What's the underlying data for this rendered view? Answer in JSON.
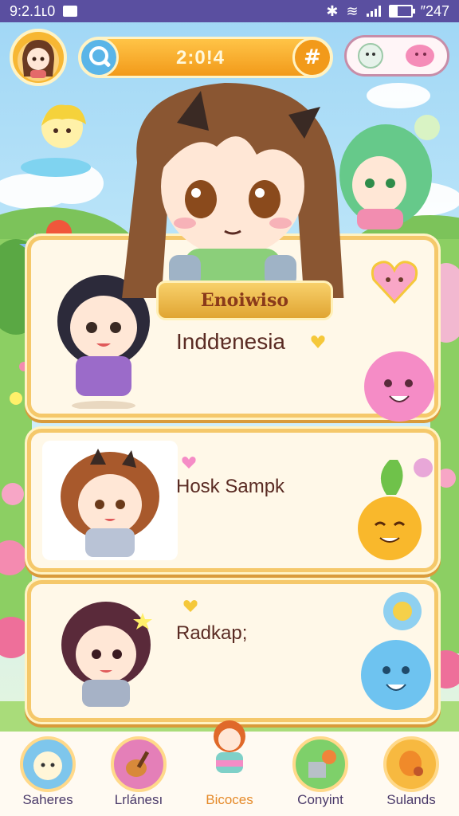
{
  "status_bar": {
    "time": "9:2.1ʟ0",
    "right_text": "″247",
    "battery_level": 0.35
  },
  "hud": {
    "search_text": "2:0ǃ4",
    "hash_symbol": "#"
  },
  "banner": {
    "title": "Enoiwiso"
  },
  "cards": [
    {
      "title": "Inddɐnesia"
    },
    {
      "title": "Hosk Sampk"
    },
    {
      "title": "Radkap;"
    }
  ],
  "nav": [
    {
      "label": "Saheres",
      "icon": "pet-icon"
    },
    {
      "label": "Lrlánesı",
      "icon": "guitar-icon"
    },
    {
      "label": "Bicoces",
      "icon": "character-icon",
      "active": true
    },
    {
      "label": "Conyint",
      "icon": "garden-icon"
    },
    {
      "label": "Sulands",
      "icon": "instrument-icon"
    }
  ],
  "colors": {
    "status_bar": "#5a4fa0",
    "card_border": "#f5c86a",
    "accent": "#f29a1a",
    "title_text": "#5a2b23"
  }
}
